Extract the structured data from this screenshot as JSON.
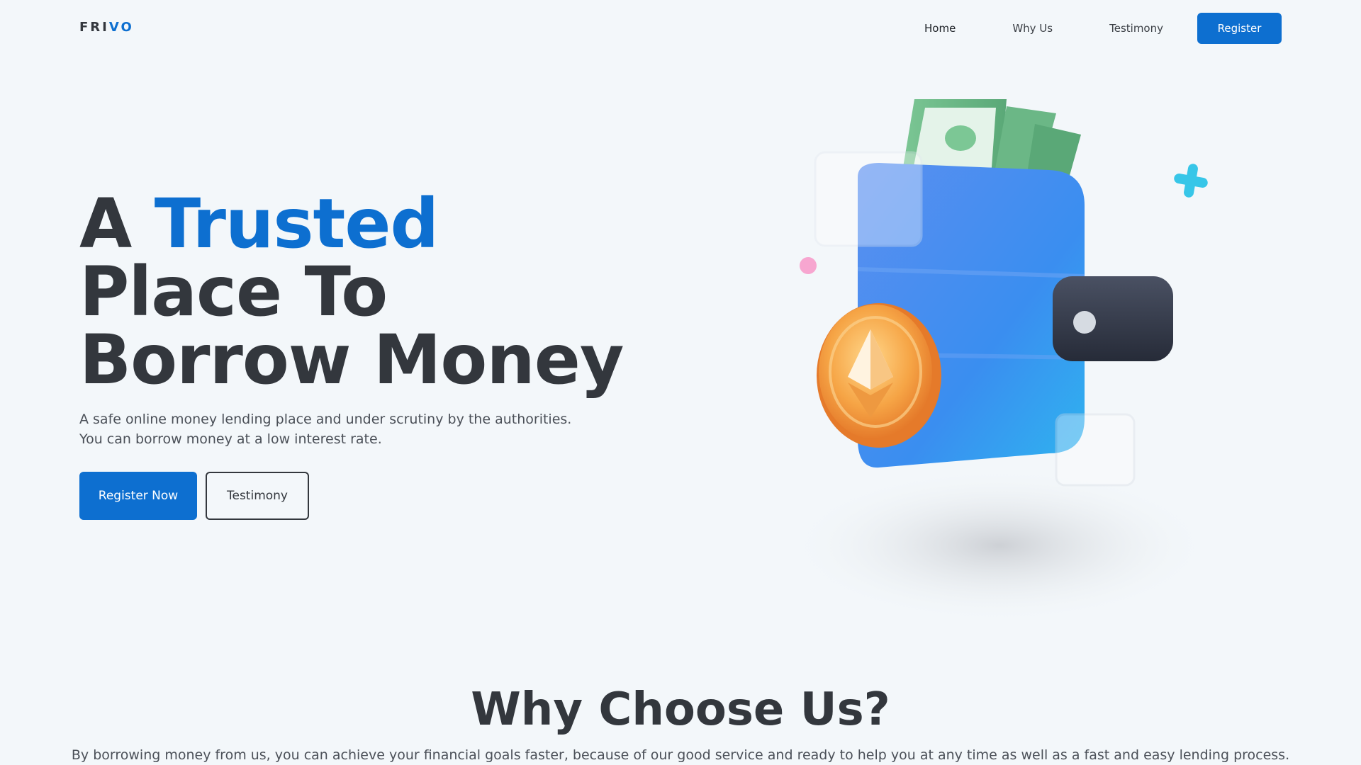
{
  "nav": {
    "logo_part1": "FRI",
    "logo_part2": "VO",
    "links": [
      "Home",
      "Why Us",
      "Testimony"
    ],
    "register_label": "Register"
  },
  "hero": {
    "title_word1": "A",
    "title_accent": "Trusted",
    "title_line2": "Place To",
    "title_line3": "Borrow Money",
    "subtitle": "A safe online money lending place and under scrutiny by the authorities. You can borrow money at a low interest rate.",
    "primary_button": "Register Now",
    "secondary_button": "Testimony"
  },
  "why": {
    "title": "Why Choose Us?",
    "subtitle": "By borrowing money from us, you can achieve your financial goals faster, because of our good service and ready to help you at any time as well as a fast and easy lending process."
  },
  "colors": {
    "accent": "#0d6fd0",
    "text": "#33373d",
    "background": "#f3f7fa"
  },
  "icons": {
    "illustration": "wallet-coin-illustration"
  }
}
